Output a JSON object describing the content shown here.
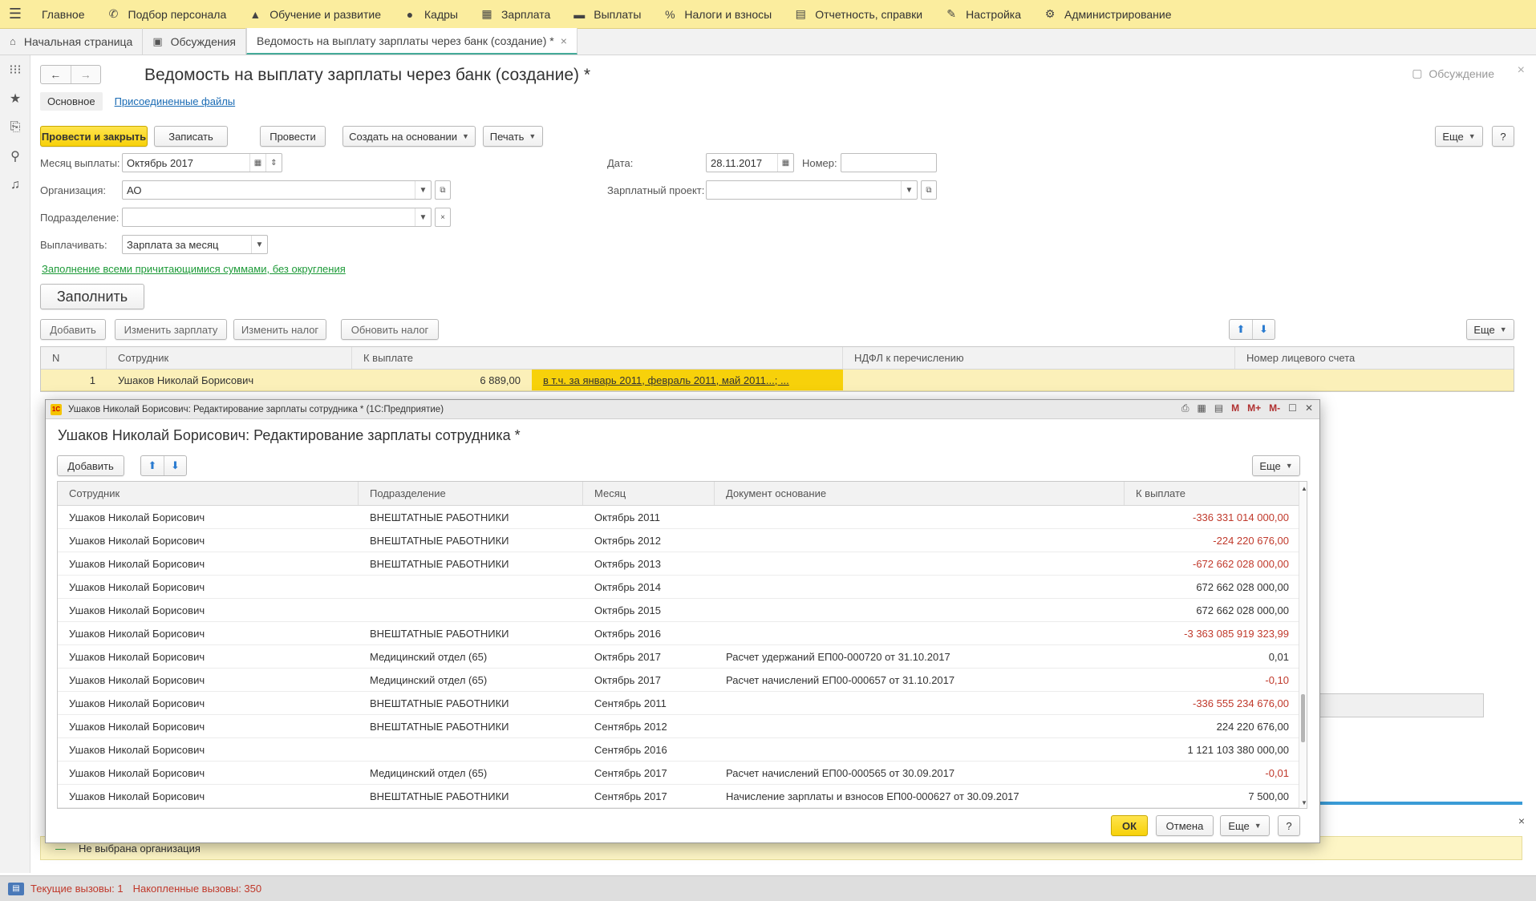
{
  "topmenu": {
    "items": [
      {
        "icon": "menu-icon",
        "label": "Главное"
      },
      {
        "icon": "phone-icon",
        "label": "Подбор персонала"
      },
      {
        "icon": "graduation-icon",
        "label": "Обучение и развитие"
      },
      {
        "icon": "people-icon",
        "label": "Кадры"
      },
      {
        "icon": "calculator-icon",
        "label": "Зарплата"
      },
      {
        "icon": "wallet-icon",
        "label": "Выплаты"
      },
      {
        "icon": "percent-icon",
        "label": "Налоги и взносы"
      },
      {
        "icon": "report-icon",
        "label": "Отчетность, справки"
      },
      {
        "icon": "wrench-icon",
        "label": "Настройка"
      },
      {
        "icon": "gear-icon",
        "label": "Администрирование"
      }
    ]
  },
  "tabs": [
    {
      "icon": "home-icon",
      "label": "Начальная страница"
    },
    {
      "icon": "chat-icon",
      "label": "Обсуждения"
    },
    {
      "label": "Ведомость на выплату зарплаты через банк (создание) *",
      "active": true
    }
  ],
  "sidebar": [
    "apps-icon",
    "star-icon",
    "history-icon",
    "search-icon",
    "bell-icon"
  ],
  "doc": {
    "title": "Ведомость на выплату зарплаты через банк (создание) *",
    "discuss": "Обсуждение",
    "subtab_main": "Основное",
    "subtab_files": "Присоединенные файлы",
    "toolbar": {
      "post_close": "Провести и закрыть",
      "save": "Записать",
      "post": "Провести",
      "create_based": "Создать на основании",
      "print": "Печать",
      "more": "Еще",
      "help": "?"
    },
    "fields": {
      "month_label": "Месяц выплаты:",
      "month_value": "Октябрь 2017",
      "org_label": "Организация:",
      "org_value": "АО",
      "dept_label": "Подразделение:",
      "dept_value": "",
      "pay_label": "Выплачивать:",
      "pay_value": "Зарплата за месяц",
      "date_label": "Дата:",
      "date_value": "28.11.2017",
      "number_label": "Номер:",
      "number_value": "",
      "project_label": "Зарплатный проект:",
      "project_value": ""
    },
    "fill_mode_link": "Заполнение всеми причитающимися суммами, без округления",
    "fill_button": "Заполнить",
    "grid_toolbar": {
      "add": "Добавить",
      "change_salary": "Изменить зарплату",
      "change_tax": "Изменить налог",
      "update_tax": "Обновить налог",
      "more": "Еще"
    },
    "grid": {
      "columns": [
        "N",
        "Сотрудник",
        "К выплате",
        "НДФЛ к перечислению",
        "Номер лицевого счета"
      ],
      "rows": [
        {
          "n": "1",
          "employee": "Ушаков Николай Борисович",
          "amount": "6 889,00",
          "detail": "в т.ч. за январь 2011, февраль 2011, май 2011...; ...",
          "ndfl": "",
          "account": ""
        }
      ]
    },
    "warning": "Не выбрана организация"
  },
  "statusbar": {
    "current": "Текущие вызовы: 1",
    "accumulated": "Накопленные вызовы: 350"
  },
  "modal": {
    "window_title": "Ушаков Николай Борисович: Редактирование зарплаты сотрудника * (1С:Предприятие)",
    "title": "Ушаков Николай Борисович: Редактирование зарплаты сотрудника *",
    "add": "Добавить",
    "more": "Еще",
    "columns": [
      "Сотрудник",
      "Подразделение",
      "Месяц",
      "Документ основание",
      "К выплате"
    ],
    "rows": [
      {
        "employee": "Ушаков Николай Борисович",
        "dept": "ВНЕШТАТНЫЕ РАБОТНИКИ",
        "month": "Октябрь 2011",
        "doc": "",
        "amount": "-336 331 014 000,00",
        "neg": true
      },
      {
        "employee": "Ушаков Николай Борисович",
        "dept": "ВНЕШТАТНЫЕ РАБОТНИКИ",
        "month": "Октябрь 2012",
        "doc": "",
        "amount": "-224 220 676,00",
        "neg": true
      },
      {
        "employee": "Ушаков Николай Борисович",
        "dept": "ВНЕШТАТНЫЕ РАБОТНИКИ",
        "month": "Октябрь 2013",
        "doc": "",
        "amount": "-672 662 028 000,00",
        "neg": true
      },
      {
        "employee": "Ушаков Николай Борисович",
        "dept": "",
        "month": "Октябрь 2014",
        "doc": "",
        "amount": "672 662 028 000,00",
        "neg": false
      },
      {
        "employee": "Ушаков Николай Борисович",
        "dept": "",
        "month": "Октябрь 2015",
        "doc": "",
        "amount": "672 662 028 000,00",
        "neg": false
      },
      {
        "employee": "Ушаков Николай Борисович",
        "dept": "ВНЕШТАТНЫЕ РАБОТНИКИ",
        "month": "Октябрь 2016",
        "doc": "",
        "amount": "-3 363 085 919 323,99",
        "neg": true
      },
      {
        "employee": "Ушаков Николай Борисович",
        "dept": "Медицинский отдел (65)",
        "month": "Октябрь 2017",
        "doc": "Расчет удержаний ЕП00-000720 от 31.10.2017",
        "amount": "0,01",
        "neg": false
      },
      {
        "employee": "Ушаков Николай Борисович",
        "dept": "Медицинский отдел (65)",
        "month": "Октябрь 2017",
        "doc": "Расчет начислений ЕП00-000657 от 31.10.2017",
        "amount": "-0,10",
        "neg": true
      },
      {
        "employee": "Ушаков Николай Борисович",
        "dept": "ВНЕШТАТНЫЕ РАБОТНИКИ",
        "month": "Сентябрь 2011",
        "doc": "",
        "amount": "-336 555 234 676,00",
        "neg": true
      },
      {
        "employee": "Ушаков Николай Борисович",
        "dept": "ВНЕШТАТНЫЕ РАБОТНИКИ",
        "month": "Сентябрь 2012",
        "doc": "",
        "amount": "224 220 676,00",
        "neg": false
      },
      {
        "employee": "Ушаков Николай Борисович",
        "dept": "",
        "month": "Сентябрь 2016",
        "doc": "",
        "amount": "1 121 103 380 000,00",
        "neg": false
      },
      {
        "employee": "Ушаков Николай Борисович",
        "dept": "Медицинский отдел (65)",
        "month": "Сентябрь 2017",
        "doc": "Расчет начислений ЕП00-000565 от 30.09.2017",
        "amount": "-0,01",
        "neg": true
      },
      {
        "employee": "Ушаков Николай Борисович",
        "dept": "ВНЕШТАТНЫЕ РАБОТНИКИ",
        "month": "Сентябрь 2017",
        "doc": "Начисление зарплаты и взносов ЕП00-000627 от 30.09.2017",
        "amount": "7 500,00",
        "neg": false
      }
    ],
    "ok": "ОК",
    "cancel": "Отмена",
    "help": "?"
  }
}
